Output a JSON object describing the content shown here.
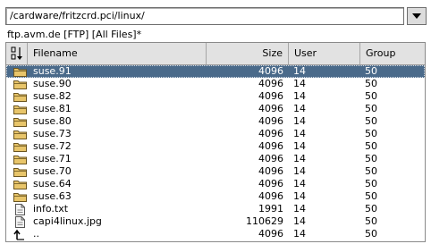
{
  "path": {
    "value": "/cardware/fritzcrd.pci/linux/"
  },
  "status": "ftp.avm.de [FTP] [All Files]*",
  "columns": {
    "filename": "Filename",
    "size": "Size",
    "user": "User",
    "group": "Group"
  },
  "rows": [
    {
      "icon": "folder-icon",
      "name": "suse.91",
      "size": "4096",
      "user": "14",
      "group": "50",
      "selected": true
    },
    {
      "icon": "folder-icon",
      "name": "suse.90",
      "size": "4096",
      "user": "14",
      "group": "50"
    },
    {
      "icon": "folder-icon",
      "name": "suse.82",
      "size": "4096",
      "user": "14",
      "group": "50"
    },
    {
      "icon": "folder-icon",
      "name": "suse.81",
      "size": "4096",
      "user": "14",
      "group": "50"
    },
    {
      "icon": "folder-icon",
      "name": "suse.80",
      "size": "4096",
      "user": "14",
      "group": "50"
    },
    {
      "icon": "folder-icon",
      "name": "suse.73",
      "size": "4096",
      "user": "14",
      "group": "50"
    },
    {
      "icon": "folder-icon",
      "name": "suse.72",
      "size": "4096",
      "user": "14",
      "group": "50"
    },
    {
      "icon": "folder-icon",
      "name": "suse.71",
      "size": "4096",
      "user": "14",
      "group": "50"
    },
    {
      "icon": "folder-icon",
      "name": "suse.70",
      "size": "4096",
      "user": "14",
      "group": "50"
    },
    {
      "icon": "folder-icon",
      "name": "suse.64",
      "size": "4096",
      "user": "14",
      "group": "50"
    },
    {
      "icon": "folder-icon",
      "name": "suse.63",
      "size": "4096",
      "user": "14",
      "group": "50"
    },
    {
      "icon": "file-icon",
      "name": "info.txt",
      "size": "1991",
      "user": "14",
      "group": "50"
    },
    {
      "icon": "file-icon",
      "name": "capi4linux.jpg",
      "size": "110629",
      "user": "14",
      "group": "50"
    },
    {
      "icon": "parent-dir-icon",
      "name": "..",
      "size": "4096",
      "user": "14",
      "group": "50"
    }
  ],
  "colors": {
    "selection": "#4a6a8a",
    "folder": "#e8c56a"
  }
}
